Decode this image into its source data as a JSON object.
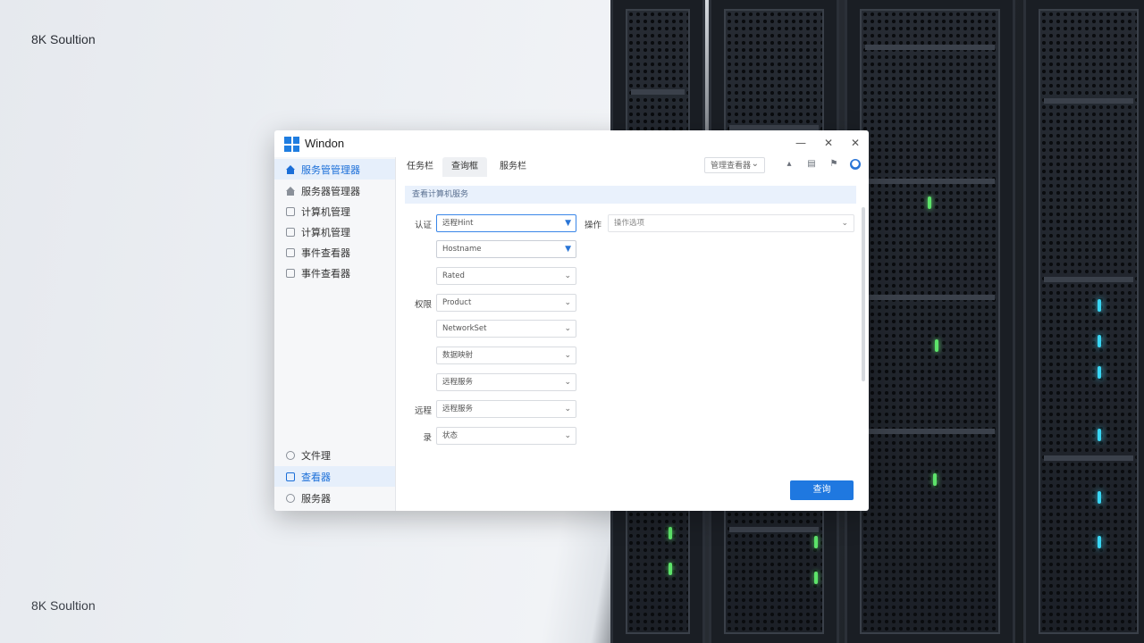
{
  "brand": {
    "top": "8K Soultion",
    "bottom": "8K Soultion"
  },
  "window": {
    "title": "Windon",
    "controls": [
      "—",
      "✕",
      "✕"
    ]
  },
  "sidebar": {
    "top_items": [
      {
        "label": "服务管管理器",
        "icon": "home-icon",
        "active": true
      },
      {
        "label": "服务器管理器",
        "icon": "home-icon",
        "active": false
      },
      {
        "label": "计算机管理",
        "icon": "square-icon",
        "active": false
      },
      {
        "label": "计算机管理",
        "icon": "square-icon",
        "active": false
      },
      {
        "label": "事件查看器",
        "icon": "square-icon",
        "active": false
      },
      {
        "label": "事件查看器",
        "icon": "square-icon",
        "active": false
      }
    ],
    "bottom_items": [
      {
        "label": "文件理",
        "icon": "lock-icon",
        "active": false
      },
      {
        "label": "查看器",
        "icon": "lock-icon",
        "active": true
      },
      {
        "label": "服务器",
        "icon": "lock-icon",
        "active": false
      }
    ]
  },
  "tabs": [
    {
      "label": "任务栏",
      "active": false
    },
    {
      "label": "查询框",
      "active": true
    },
    {
      "label": "服务栏",
      "active": false
    }
  ],
  "toolbar": {
    "select_value": "管理查看器",
    "icons": [
      "chart-icon",
      "document-icon",
      "flag-icon",
      "settings-icon"
    ]
  },
  "banner": "查看计算机服务",
  "form": {
    "group1_label": "认证",
    "group2_label": "权限",
    "group3_label": "远程",
    "group4_label": "录",
    "side_label": "操作",
    "side_field": "操作选项",
    "fields": [
      "远程Hint",
      "Hostname",
      "Rated",
      "Product",
      "NetworkSet",
      "数据映射",
      "远程服务",
      "远程服务",
      "状态"
    ],
    "submit": "查询"
  }
}
